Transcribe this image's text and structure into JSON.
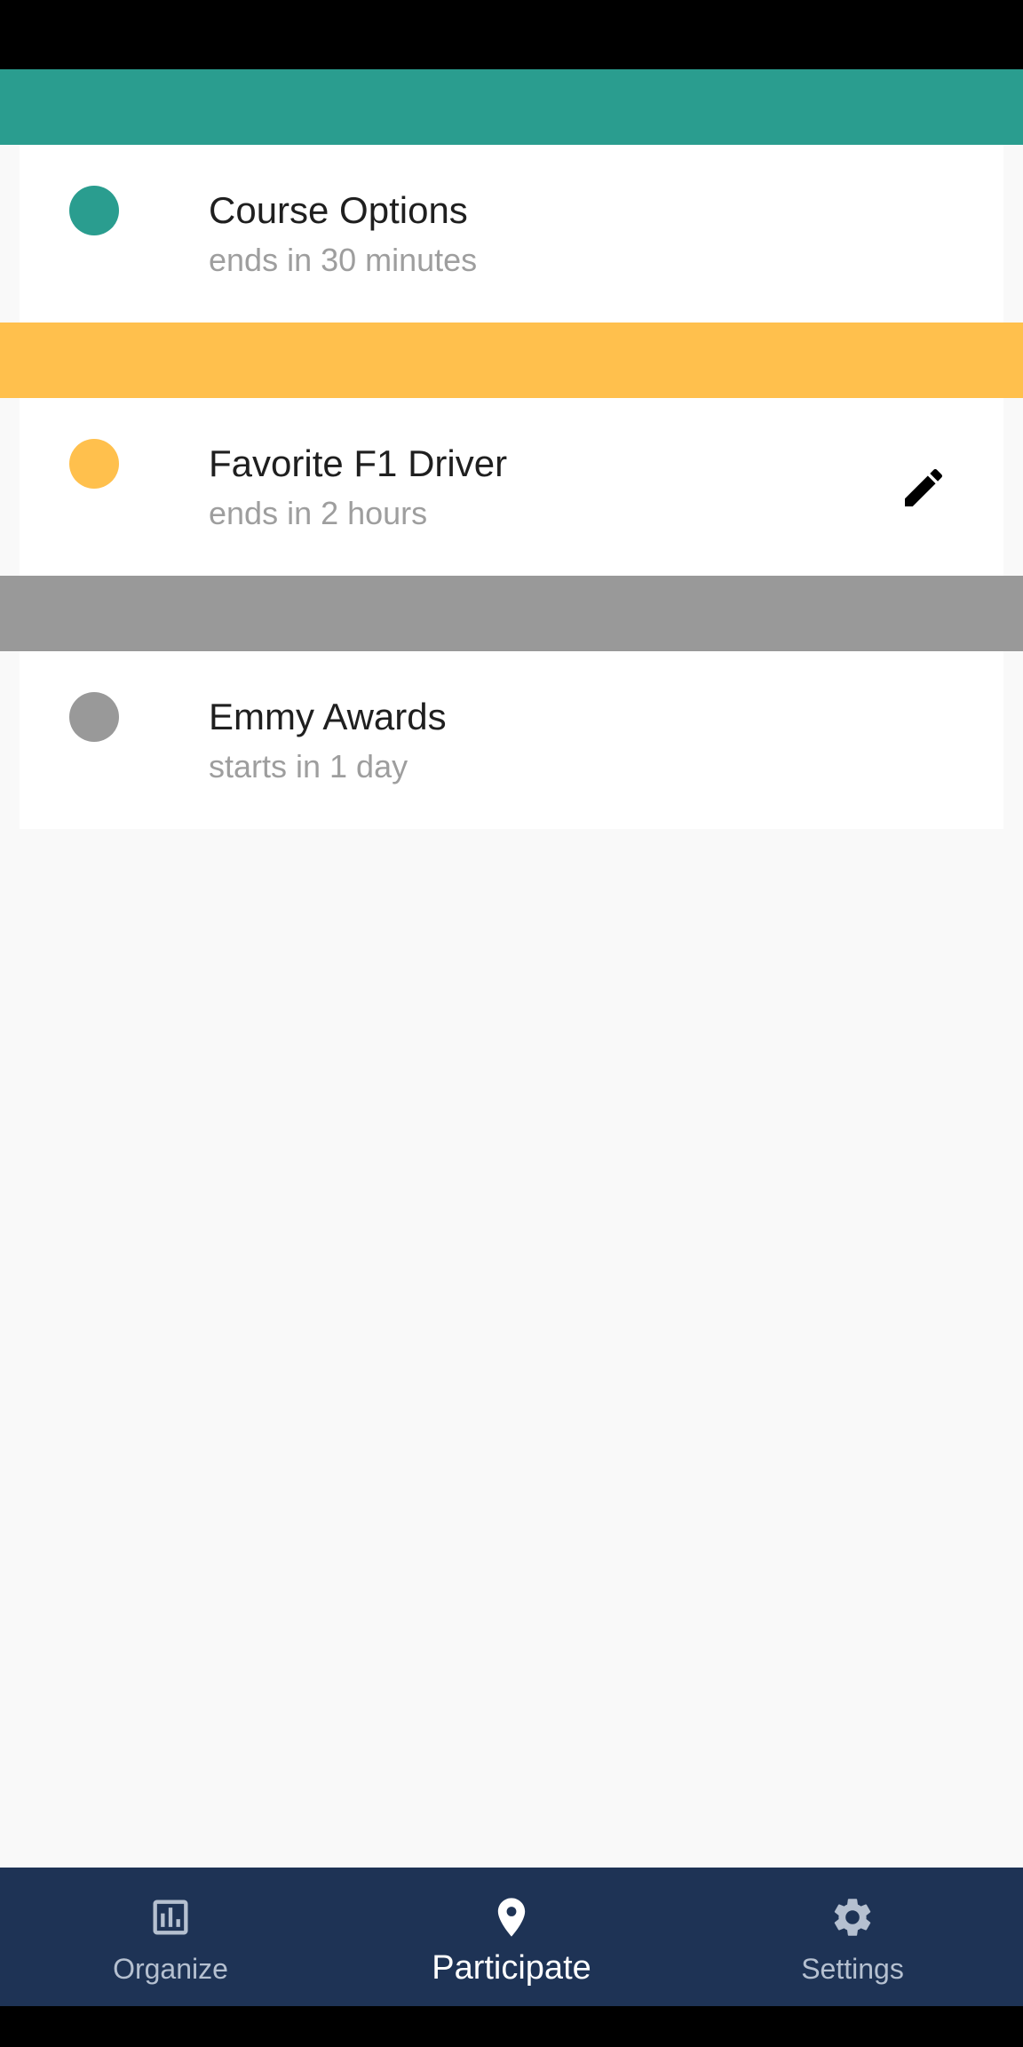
{
  "polls": [
    {
      "title": "Course Options",
      "subtitle": "ends in 30 minutes",
      "color": "#2a9d8f",
      "editable": false
    },
    {
      "title": "Favorite F1 Driver",
      "subtitle": "ends in 2 hours",
      "color": "#ffc04d",
      "editable": true
    },
    {
      "title": "Emmy Awards",
      "subtitle": "starts in 1 day",
      "color": "#999999",
      "editable": false
    }
  ],
  "nav": {
    "items": [
      {
        "label": "Organize",
        "icon": "bar-chart-icon",
        "active": false
      },
      {
        "label": "Participate",
        "icon": "location-pin-icon",
        "active": true
      },
      {
        "label": "Settings",
        "icon": "gear-icon",
        "active": false
      }
    ]
  },
  "colors": {
    "nav_background": "#1e3355",
    "page_background": "#f9f9f9"
  }
}
